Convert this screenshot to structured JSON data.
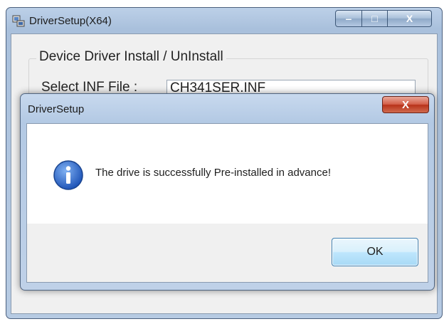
{
  "main_window": {
    "title": "DriverSetup(X64)",
    "group_title": "Device Driver Install / UnInstall",
    "inf_label": "Select INF File :",
    "inf_value": "CH341SER.INF",
    "min_glyph": "‒",
    "max_glyph": "□",
    "close_glyph": "X"
  },
  "dialog": {
    "title": "DriverSetup",
    "message": "The drive is successfully Pre-installed in advance!",
    "ok_label": "OK",
    "close_glyph": "X",
    "icon": "info-icon"
  },
  "colors": {
    "title_bar": "#b3c9e4",
    "close_button": "#c7432b",
    "ok_button_border": "#3c7fb1",
    "info_icon": "#2d66c8"
  }
}
